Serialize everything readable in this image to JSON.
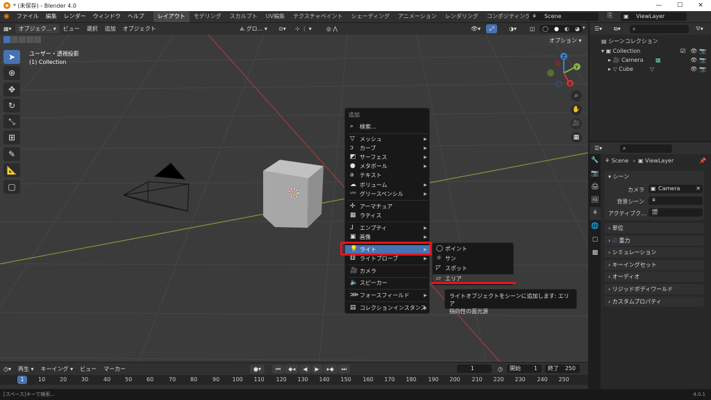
{
  "window": {
    "title": "* (未保存) - Blender 4.0",
    "min": "—",
    "max": "☐",
    "close": "✕"
  },
  "menubar": {
    "items": [
      "ファイル",
      "編集",
      "レンダー",
      "ウィンドウ",
      "ヘルプ"
    ],
    "workspaces": [
      "レイアウト",
      "モデリング",
      "スカルプト",
      "UV編集",
      "テクスチャペイント",
      "シェーディング",
      "アニメーション",
      "レンダリング",
      "コンポジティング"
    ],
    "active_workspace": 0,
    "scene": "Scene",
    "view_layer": "ViewLayer"
  },
  "viewport_header": {
    "mode": "オブジェク...",
    "items": [
      "ビュー",
      "選択",
      "追加",
      "オブジェクト"
    ],
    "orientation": "グロ...",
    "options": "オプション"
  },
  "viewport": {
    "overlay_title": "ユーザー・透視投影",
    "overlay_sub": "(1) Collection"
  },
  "gizmo": {
    "z": "Z",
    "y": "Y",
    "x": "X"
  },
  "add_menu": {
    "title": "追加",
    "search": "検索...",
    "items": [
      {
        "label": "メッシュ",
        "icon": "mesh-icon",
        "sub": true
      },
      {
        "label": "カーブ",
        "icon": "curve-icon",
        "sub": true
      },
      {
        "label": "サーフェス",
        "icon": "surface-icon",
        "sub": true
      },
      {
        "label": "メタボール",
        "icon": "metaball-icon",
        "sub": true
      },
      {
        "label": "テキスト",
        "icon": "text-icon",
        "sub": false
      },
      {
        "label": "ボリューム",
        "icon": "volume-icon",
        "sub": true
      },
      {
        "label": "グリースペンシル",
        "icon": "grease-pencil-icon",
        "sub": true
      },
      {
        "label": "アーマチュア",
        "icon": "armature-icon",
        "sub": false
      },
      {
        "label": "ラティス",
        "icon": "lattice-icon",
        "sub": false
      },
      {
        "label": "エンプティ",
        "icon": "empty-icon",
        "sub": true
      },
      {
        "label": "画像",
        "icon": "image-icon",
        "sub": true
      },
      {
        "label": "ライト",
        "icon": "light-icon",
        "sub": true
      },
      {
        "label": "ライトプローブ",
        "icon": "light-probe-icon",
        "sub": true
      },
      {
        "label": "カメラ",
        "icon": "camera-icon",
        "sub": false
      },
      {
        "label": "スピーカー",
        "icon": "speaker-icon",
        "sub": false
      },
      {
        "label": "フォースフィールド",
        "icon": "force-field-icon",
        "sub": true
      },
      {
        "label": "コレクションインスタンス",
        "icon": "collection-icon",
        "sub": true
      }
    ]
  },
  "light_submenu": {
    "items": [
      "ポイント",
      "サン",
      "スポット",
      "エリア"
    ]
  },
  "tooltip": {
    "line1": "ライトオブジェクトをシーンに追加します: エリア",
    "line2": "指向性の面光源"
  },
  "outliner": {
    "title": "シーンコレクション",
    "collection": "Collection",
    "objects": [
      "Camera",
      "Cube"
    ]
  },
  "properties": {
    "scene_label": "Scene",
    "view_layer": "ViewLayer",
    "section": "シーン",
    "camera_label": "カメラ",
    "camera_value": "Camera",
    "bg_scene_label": "背景シーン",
    "active_clip_label": "アクティブク...",
    "panels": [
      "単位",
      "重力",
      "シミュレーション",
      "キーイングセット",
      "オーディオ",
      "リジッドボディワールド",
      "カスタムプロパティ"
    ]
  },
  "timeline": {
    "items": [
      "再生",
      "キーイング",
      "ビュー",
      "マーカー"
    ],
    "current_frame": "1",
    "start_label": "開始",
    "start": "1",
    "end_label": "終了",
    "end": "250",
    "ticks": [
      "1",
      "10",
      "20",
      "30",
      "40",
      "50",
      "60",
      "70",
      "80",
      "90",
      "100",
      "110",
      "120",
      "130",
      "140",
      "150",
      "160",
      "170",
      "180",
      "190",
      "200",
      "210",
      "220",
      "230",
      "240",
      "250"
    ]
  },
  "status": {
    "left": "[スペース]キーで検索...",
    "version": "4.0.1"
  },
  "colors": {
    "accent": "#4772b3",
    "highlight_red": "#e3171d",
    "x_axis": "#c8353b",
    "y_axis": "#8bb34a",
    "z_axis": "#3b82d8"
  }
}
